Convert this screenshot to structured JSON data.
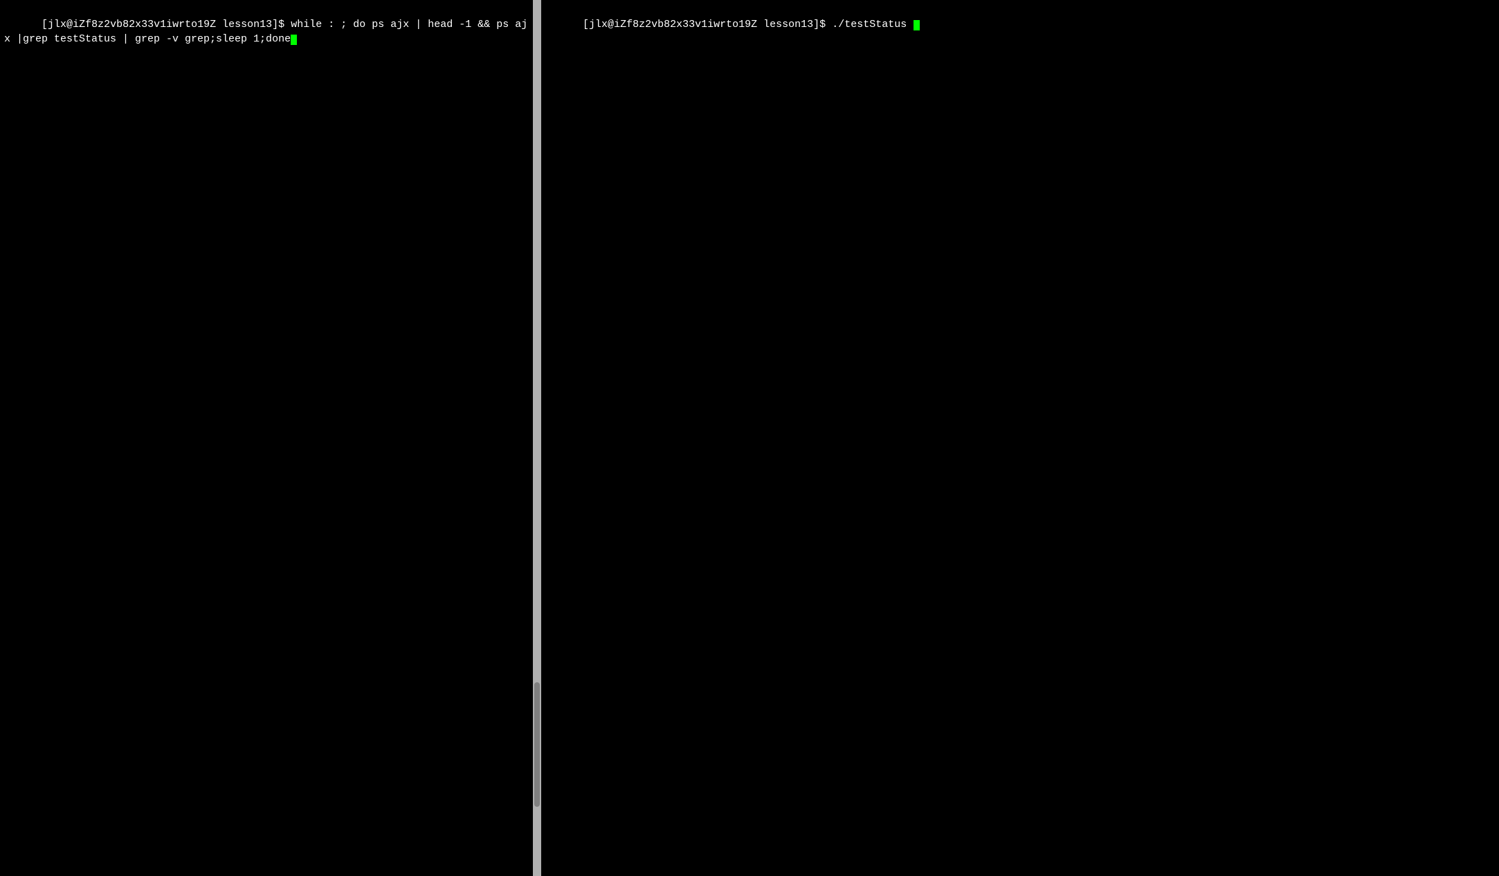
{
  "left_pane": {
    "prompt_user": "jlx",
    "prompt_at": "@",
    "prompt_host": "iZf8z2vb82x33v1iwrto19Z",
    "prompt_dir": "lesson13",
    "prompt_symbol": "$",
    "command_line1": "while : ; do ps ajx | head -1 && ps ajx |grep testStatus | grep -v grep;sleep 1;done",
    "cursor_visible": true
  },
  "right_pane": {
    "prompt_user": "jlx",
    "prompt_at": "@",
    "prompt_host": "iZf8z2vb82x33v1iwrto19Z",
    "prompt_dir": "lesson13",
    "prompt_symbol": "$",
    "command": "./testStatus ",
    "cursor_visible": true
  },
  "divider": {
    "color": "#b0b0b0",
    "scrollbar_color": "#808080"
  }
}
